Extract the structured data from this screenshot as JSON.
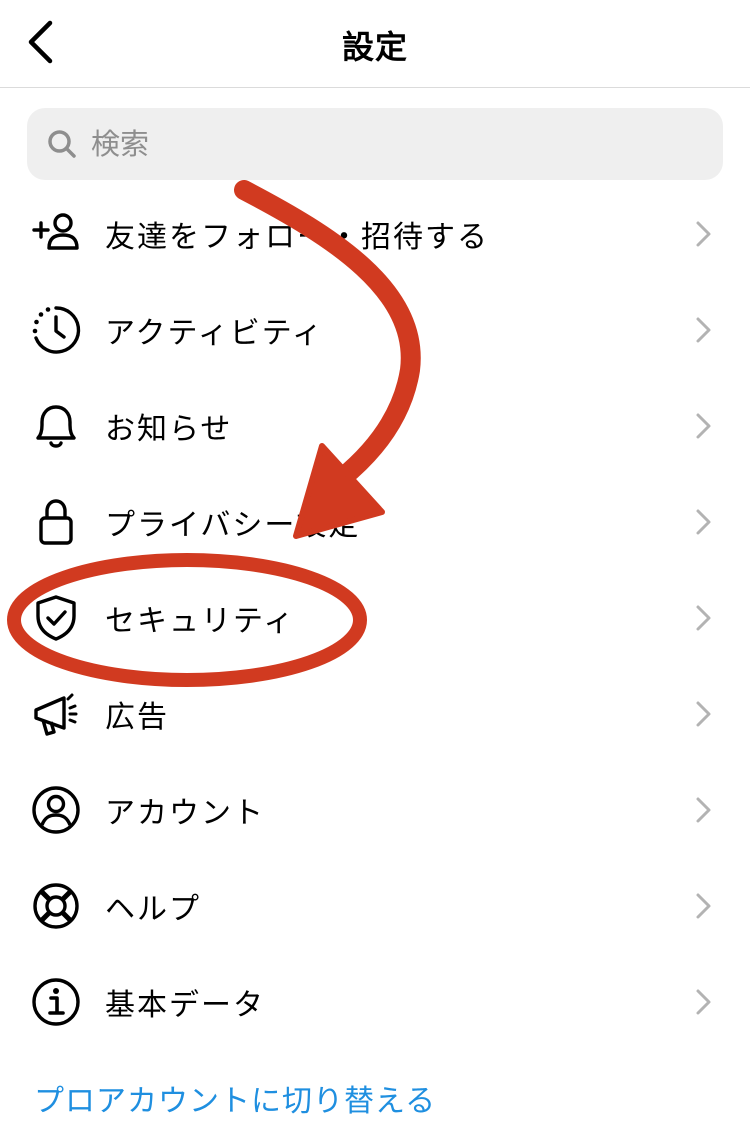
{
  "header": {
    "title": "設定"
  },
  "search": {
    "placeholder": "検索"
  },
  "menu": [
    {
      "label": "友達をフォロー・招待する",
      "icon": "add-person-icon"
    },
    {
      "label": "アクティビティ",
      "icon": "activity-clock-icon"
    },
    {
      "label": "お知らせ",
      "icon": "bell-icon"
    },
    {
      "label": "プライバシー設定",
      "icon": "lock-icon"
    },
    {
      "label": "セキュリティ",
      "icon": "shield-check-icon"
    },
    {
      "label": "広告",
      "icon": "megaphone-icon"
    },
    {
      "label": "アカウント",
      "icon": "account-circle-icon"
    },
    {
      "label": "ヘルプ",
      "icon": "lifebuoy-icon"
    },
    {
      "label": "基本データ",
      "icon": "info-icon"
    }
  ],
  "footer": {
    "pro_link": "プロアカウントに切り替える"
  },
  "colors": {
    "link": "#1f8fe0",
    "annotation": "#d13a20",
    "search_bg": "#efefef"
  }
}
